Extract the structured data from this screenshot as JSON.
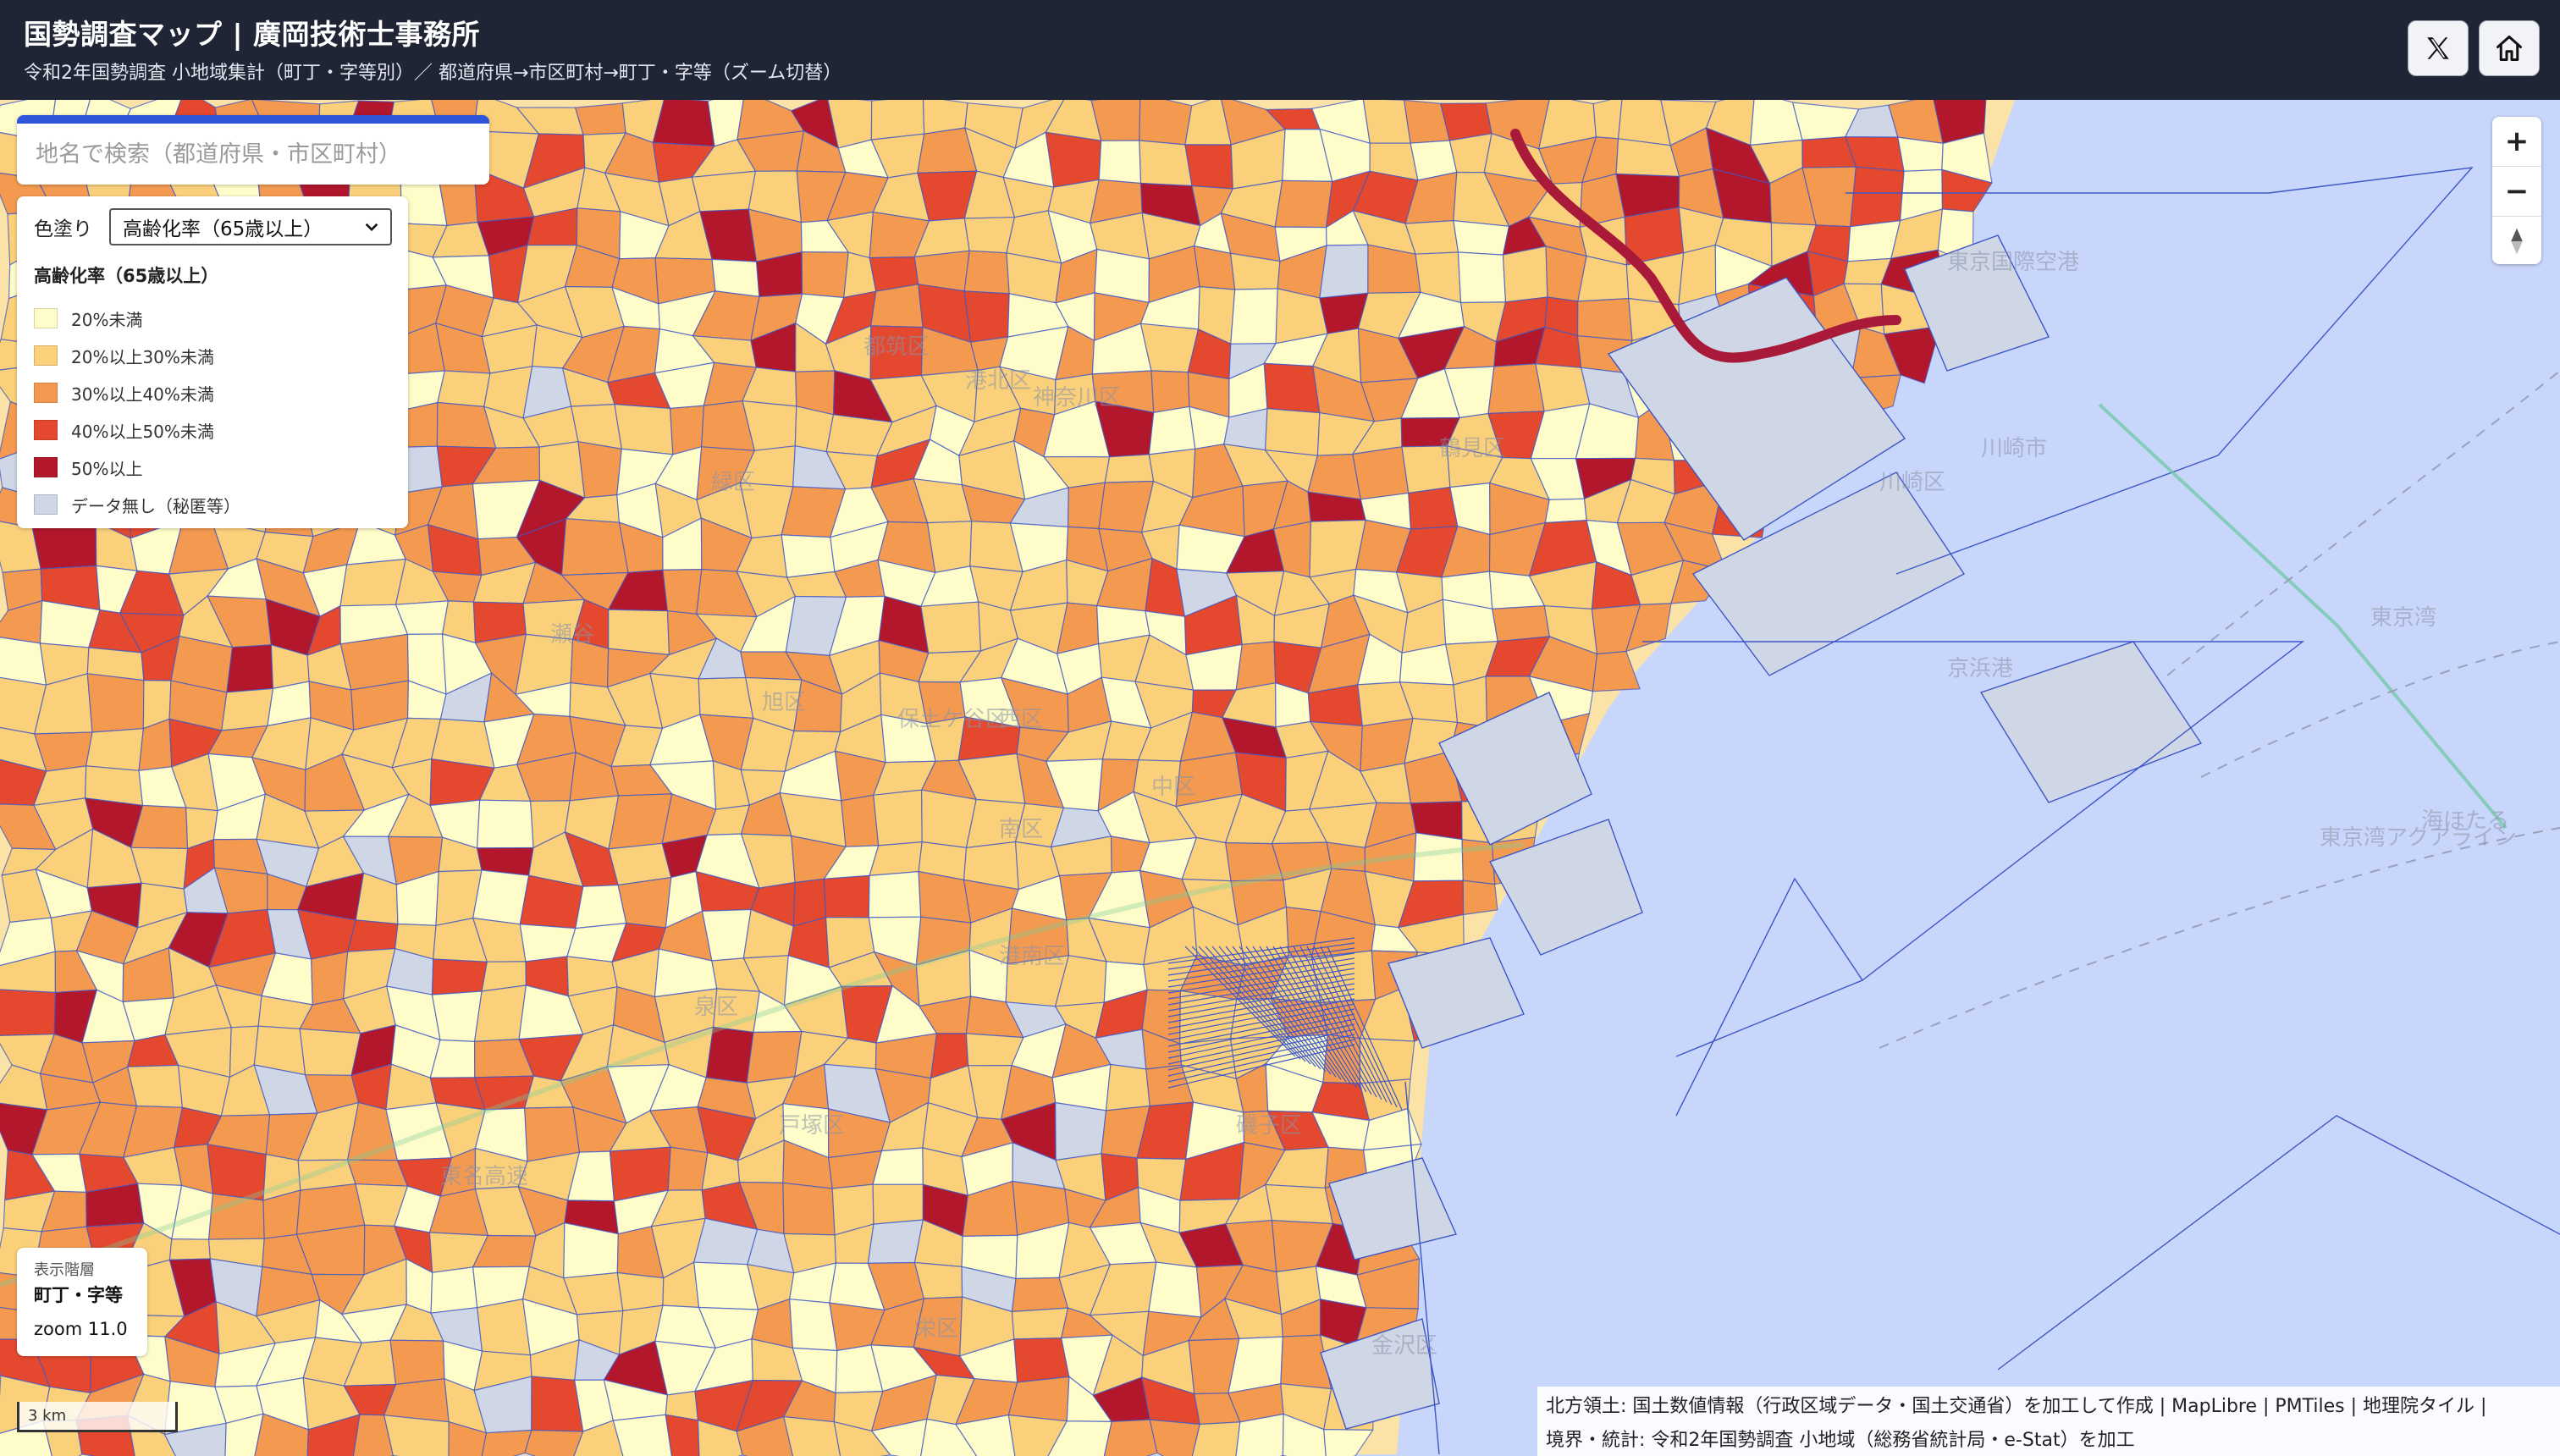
{
  "header": {
    "title": "国勢調査マップ | 廣岡技術士事務所",
    "subtitle": "令和2年国勢調査 小地域集計（町丁・字等別）／ 都道府県→市区町村→町丁・字等（ズーム切替）"
  },
  "header_buttons": [
    {
      "name": "x-button",
      "icon": "x-logo-icon"
    },
    {
      "name": "home-button",
      "icon": "home-icon"
    }
  ],
  "search": {
    "placeholder": "地名で検索（都道府県・市区町村）",
    "value": ""
  },
  "legend": {
    "label": "色塗り",
    "selected": "高齢化率（65歳以上）",
    "title": "高齢化率（65歳以上）",
    "items": [
      {
        "label": "20%未満",
        "color": "#fefcc8"
      },
      {
        "label": "20%以上30%未満",
        "color": "#fbd07a"
      },
      {
        "label": "30%以上40%未満",
        "color": "#f39a50"
      },
      {
        "label": "40%以上50%未満",
        "color": "#e4492f"
      },
      {
        "label": "50%以上",
        "color": "#b3172c"
      },
      {
        "label": "データ無し（秘匿等）",
        "color": "#cfd7e6"
      }
    ]
  },
  "zoom_controls": {
    "in": "+",
    "out": "−",
    "compass": "compass-icon"
  },
  "layer_info": {
    "label": "表示階層",
    "value": "町丁・字等",
    "zoom": "zoom 11.0"
  },
  "scale": "3 km",
  "attribution": {
    "line1": "北方領土: 国土数値情報（行政区域データ・国土交通省）を加工して作成 | MapLibre | PMTiles | 地理院タイル |",
    "line2": "境界・統計: 令和2年国勢調査 小地域（総務省統計局・e-Stat）を加工"
  },
  "map_labels": [
    "東京国際空港",
    "川崎市",
    "川崎区",
    "東京湾アクアライン",
    "京浜港",
    "海ほたる",
    "緑区",
    "瀬谷",
    "旭区",
    "港北区",
    "都筑区",
    "神奈川区",
    "西区",
    "中区",
    "南区",
    "港南区",
    "保土ケ谷区",
    "泉区",
    "戸塚区",
    "栄区",
    "磯子区",
    "金沢区",
    "鶴見区",
    "東京湾",
    "東名高速"
  ],
  "colors": {
    "header_bg": "#1f2535",
    "sea": "#c9d6fb",
    "boundary": "#3d57c7",
    "accent": "#2d54d9"
  }
}
